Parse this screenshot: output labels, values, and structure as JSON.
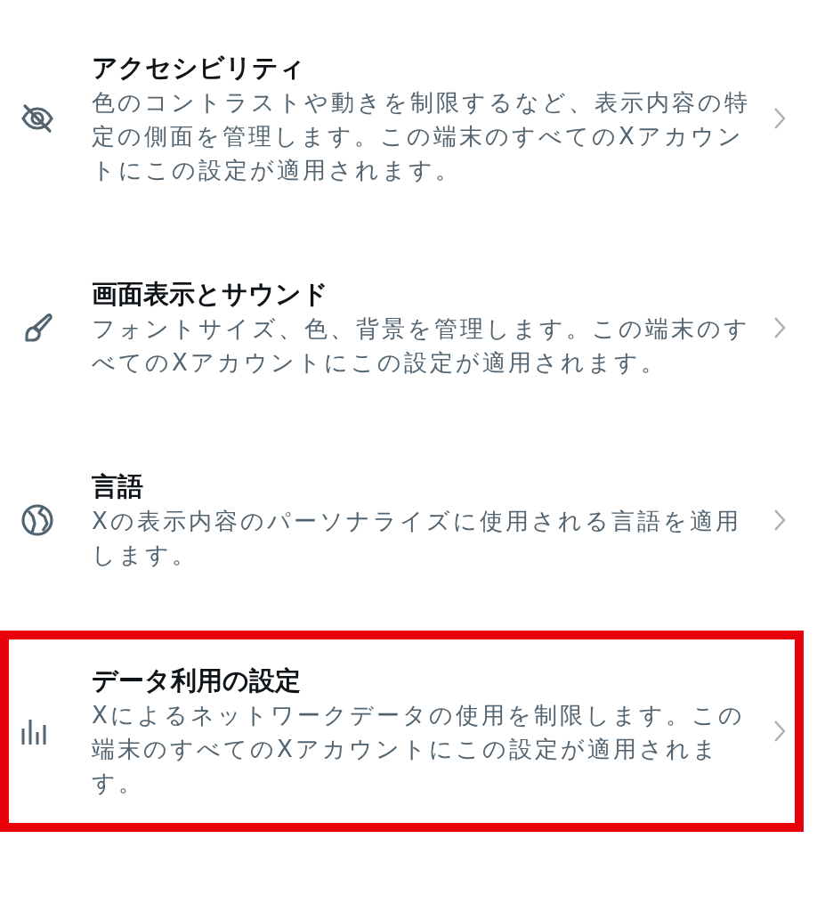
{
  "settings_items": [
    {
      "kind": "eye-off",
      "title": "アクセシビリティ",
      "description": "色のコントラストや動きを制限するなど、表示内容の特定の側面を管理します。この端末のすべてのXアカウントにこの設定が適用されます。",
      "highlighted": false
    },
    {
      "kind": "brush",
      "title": "画面表示とサウンド",
      "description": "フォントサイズ、色、背景を管理します。この端末のすべてのXアカウントにこの設定が適用されます。",
      "highlighted": false
    },
    {
      "kind": "globe",
      "title": "言語",
      "description": "Xの表示内容のパーソナライズに使用される言語を適用します。",
      "highlighted": false
    },
    {
      "kind": "bars",
      "title": "データ利用の設定",
      "description": "Xによるネットワークデータの使用を制限します。この端末のすべてのXアカウントにこの設定が適用されます。",
      "highlighted": true
    }
  ]
}
